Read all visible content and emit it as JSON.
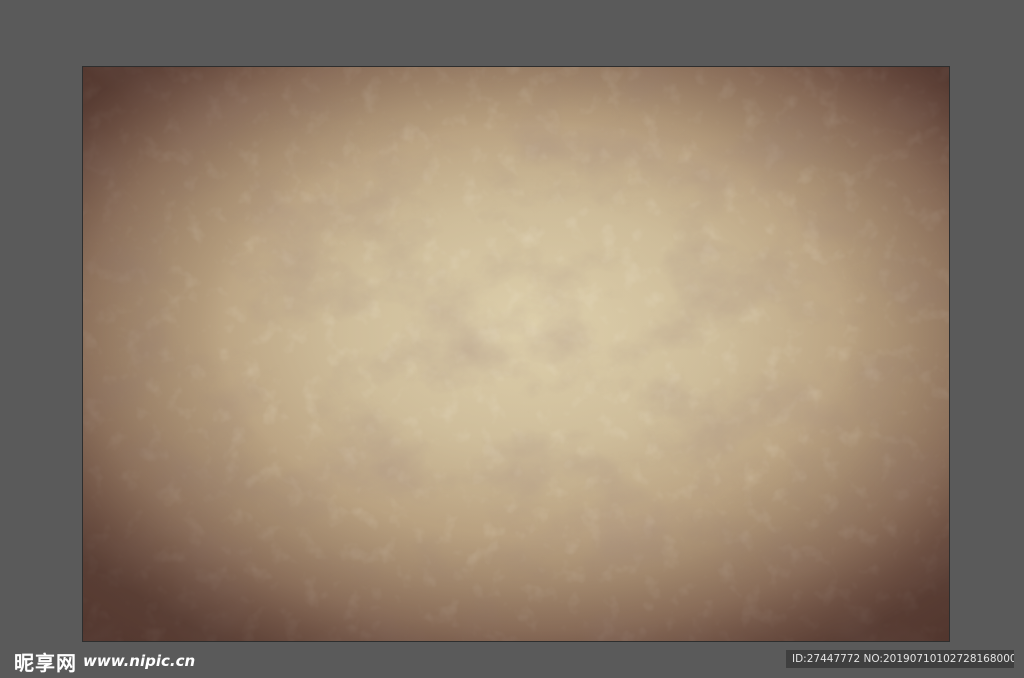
{
  "canvas": {
    "background_color": "#5a5a5a",
    "artboard": {
      "description_colors": {
        "center": "#ddd0ac",
        "mid": "#c4ad8a",
        "edge": "#6f4f45"
      }
    }
  },
  "watermark": {
    "site_name": "昵享网",
    "site_url": "www.nipic.cn",
    "id_text": "ID:27447772 NO:20190710102728168000"
  }
}
